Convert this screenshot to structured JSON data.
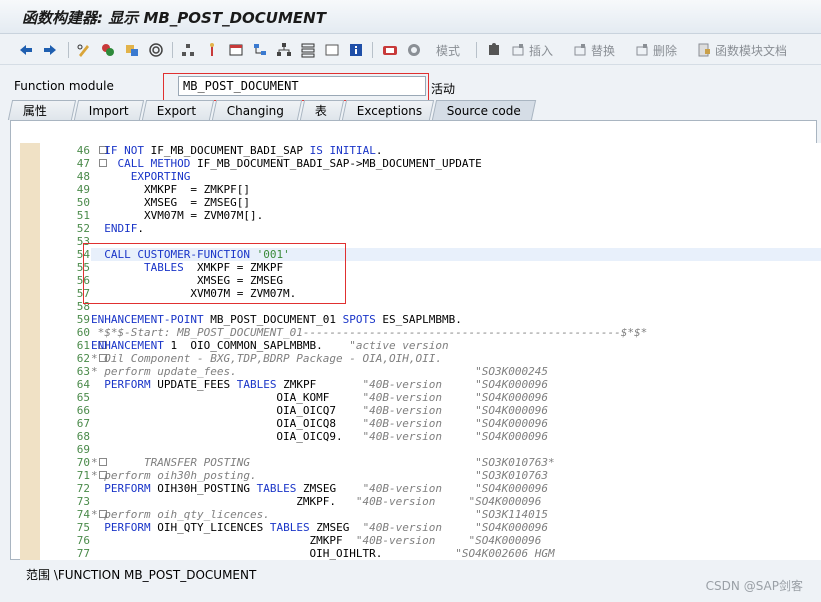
{
  "window": {
    "title": "函数构建器: 显示 MB_POST_DOCUMENT"
  },
  "toolbar": {
    "btn_mode": "模式",
    "btn_insert": "插入",
    "btn_replace": "替换",
    "btn_delete": "删除",
    "btn_fm_doc": "函数模块文档"
  },
  "function_module": {
    "label": "Function module",
    "value": "MB_POST_DOCUMENT",
    "status": "活动"
  },
  "tabs": [
    {
      "label": "属性"
    },
    {
      "label": "Import"
    },
    {
      "label": "Export"
    },
    {
      "label": "Changing"
    },
    {
      "label": "表"
    },
    {
      "label": "Exceptions"
    },
    {
      "label": "Source code"
    }
  ],
  "code": [
    {
      "n": "46",
      "t": "  IF NOT IF_MB_DOCUMENT_BADI_SAP IS INITIAL."
    },
    {
      "n": "47",
      "t": "    CALL METHOD IF_MB_DOCUMENT_BADI_SAP->MB_DOCUMENT_UPDATE"
    },
    {
      "n": "48",
      "t": "      EXPORTING"
    },
    {
      "n": "49",
      "t": "        XMKPF  = ZMKPF[]"
    },
    {
      "n": "50",
      "t": "        XMSEG  = ZMSEG[]"
    },
    {
      "n": "51",
      "t": "        XVM07M = ZVM07M[]."
    },
    {
      "n": "52",
      "t": "  ENDIF."
    },
    {
      "n": "53",
      "t": ""
    },
    {
      "n": "54",
      "t": "  CALL CUSTOMER-FUNCTION '001'"
    },
    {
      "n": "55",
      "t": "        TABLES  XMKPF = ZMKPF"
    },
    {
      "n": "56",
      "t": "                XMSEG = ZMSEG"
    },
    {
      "n": "57",
      "t": "               XVM07M = ZVM07M."
    },
    {
      "n": "58",
      "t": ""
    },
    {
      "n": "59",
      "t": "ENHANCEMENT-POINT MB_POST_DOCUMENT_01 SPOTS ES_SAPLMBMB."
    },
    {
      "n": "60",
      "t": " *$*$-Start: MB_POST_DOCUMENT_01------------------------------------------------$*$*"
    },
    {
      "n": "61",
      "t": "ENHANCEMENT 1  OIO_COMMON_SAPLMBMB.    \"active version"
    },
    {
      "n": "62",
      "t": "* Oil Component - BXG,TDP,BDRP Package - OIA,OIH,OII."
    },
    {
      "n": "63",
      "t": "* perform update_fees.                                    \"SO3K000245"
    },
    {
      "n": "64",
      "t": "  PERFORM UPDATE_FEES TABLES ZMKPF       \"40B-version     \"SO4K000096"
    },
    {
      "n": "65",
      "t": "                            OIA_KOMF     \"40B-version     \"SO4K000096"
    },
    {
      "n": "66",
      "t": "                            OIA_OICQ7    \"40B-version     \"SO4K000096"
    },
    {
      "n": "67",
      "t": "                            OIA_OICQ8    \"40B-version     \"SO4K000096"
    },
    {
      "n": "68",
      "t": "                            OIA_OICQ9.   \"40B-version     \"SO4K000096"
    },
    {
      "n": "69",
      "t": ""
    },
    {
      "n": "70",
      "t": "*       TRANSFER POSTING                                  \"SO3K010763*"
    },
    {
      "n": "71",
      "t": "* perform oih30h_posting.                                 \"SO3K010763"
    },
    {
      "n": "72",
      "t": "  PERFORM OIH30H_POSTING TABLES ZMSEG    \"40B-version     \"SO4K000096"
    },
    {
      "n": "73",
      "t": "                               ZMKPF.   \"40B-version     \"SO4K000096"
    },
    {
      "n": "74",
      "t": "* perform oih_qty_licences.                               \"SO3K114015"
    },
    {
      "n": "75",
      "t": "  PERFORM OIH_QTY_LICENCES TABLES ZMSEG  \"40B-version     \"SO4K000096"
    },
    {
      "n": "76",
      "t": "                                 ZMKPF  \"40B-version     \"SO4K000096"
    },
    {
      "n": "77",
      "t": "                                 OIH_OIHLTR.           \"SO4K002606 HGM"
    }
  ],
  "statusbar": {
    "scope": "范围 \\FUNCTION MB_POST_DOCUMENT",
    "watermark": "CSDN @SAP剑客"
  }
}
